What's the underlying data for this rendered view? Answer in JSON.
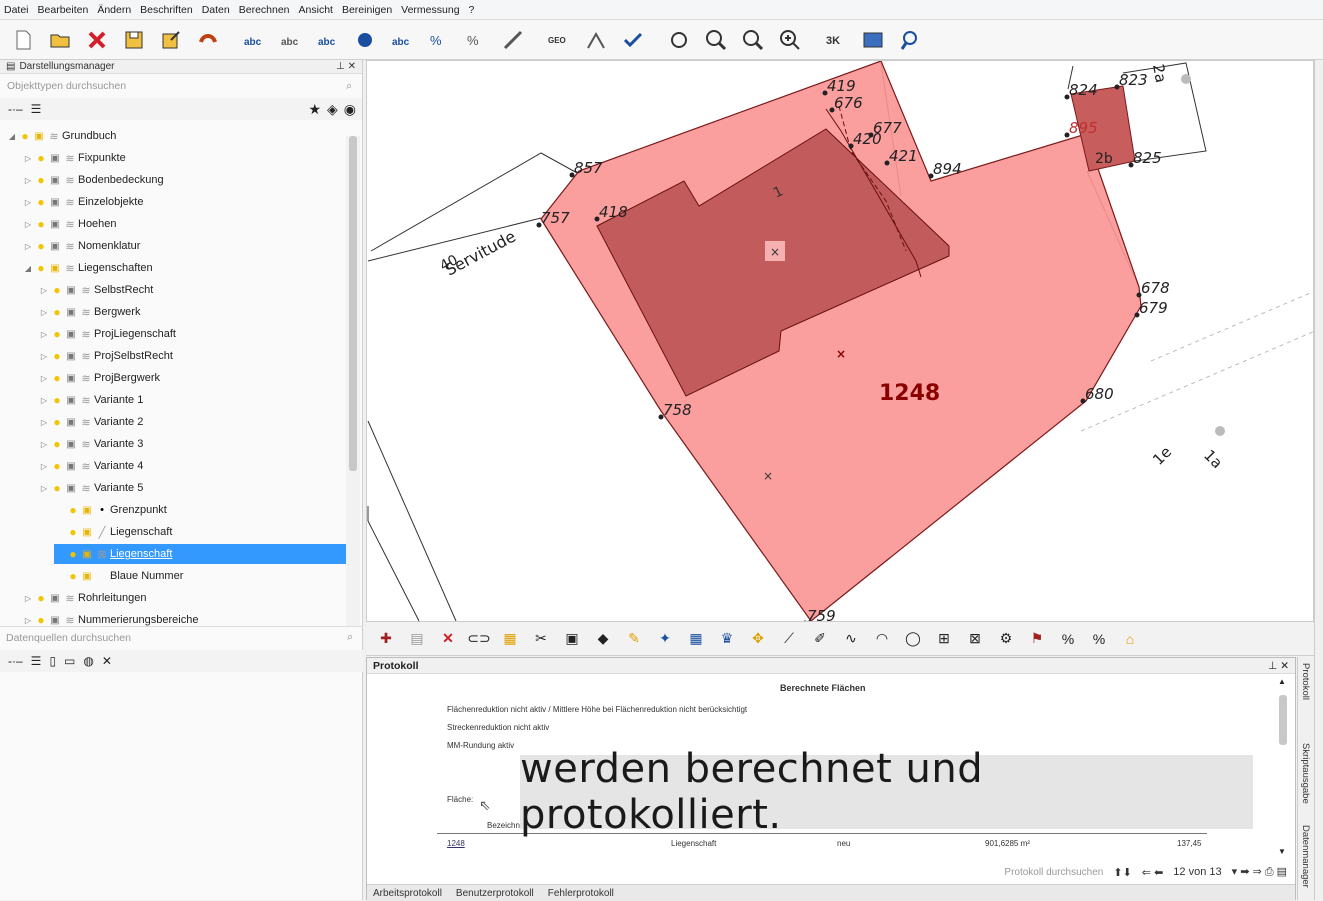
{
  "menu": [
    "Datei",
    "Bearbeiten",
    "Ändern",
    "Beschriften",
    "Daten",
    "Berechnen",
    "Ansicht",
    "Bereinigen",
    "Vermessung",
    "?"
  ],
  "display_manager": {
    "title": "Darstellungsmanager",
    "search_placeholder": "Objekttypen durchsuchen",
    "items": [
      {
        "label": "Grundbuch",
        "level": 0,
        "exp": "◢"
      },
      {
        "label": "Fixpunkte",
        "level": 1,
        "exp": "▷"
      },
      {
        "label": "Bodenbedeckung",
        "level": 1,
        "exp": "▷"
      },
      {
        "label": "Einzelobjekte",
        "level": 1,
        "exp": "▷"
      },
      {
        "label": "Hoehen",
        "level": 1,
        "exp": "▷"
      },
      {
        "label": "Nomenklatur",
        "level": 1,
        "exp": "▷"
      },
      {
        "label": "Liegenschaften",
        "level": 1,
        "exp": "◢"
      },
      {
        "label": "SelbstRecht",
        "level": 2,
        "exp": "▷"
      },
      {
        "label": "Bergwerk",
        "level": 2,
        "exp": "▷"
      },
      {
        "label": "ProjLiegenschaft",
        "level": 2,
        "exp": "▷"
      },
      {
        "label": "ProjSelbstRecht",
        "level": 2,
        "exp": "▷"
      },
      {
        "label": "ProjBergwerk",
        "level": 2,
        "exp": "▷"
      },
      {
        "label": "Variante 1",
        "level": 2,
        "exp": "▷"
      },
      {
        "label": "Variante 2",
        "level": 2,
        "exp": "▷"
      },
      {
        "label": "Variante 3",
        "level": 2,
        "exp": "▷"
      },
      {
        "label": "Variante 4",
        "level": 2,
        "exp": "▷"
      },
      {
        "label": "Variante 5",
        "level": 2,
        "exp": "▷"
      },
      {
        "label": "Grenzpunkt",
        "level": 3,
        "exp": ""
      },
      {
        "label": "Liegenschaft",
        "level": 3,
        "exp": ""
      },
      {
        "label": "Liegenschaft",
        "level": 3,
        "exp": "",
        "selected": true
      },
      {
        "label": "Blaue Nummer",
        "level": 3,
        "exp": ""
      },
      {
        "label": "Rohrleitungen",
        "level": 1,
        "exp": "▷"
      },
      {
        "label": "Nummerierungsbereiche",
        "level": 1,
        "exp": "▷"
      }
    ]
  },
  "datasources": {
    "search_placeholder": "Datenquellen durchsuchen"
  },
  "map": {
    "parcel_number": "1248",
    "points": [
      "419",
      "676",
      "677",
      "420",
      "421",
      "894",
      "857",
      "757",
      "418",
      "824",
      "823",
      "895",
      "825",
      "678",
      "679",
      "680",
      "758",
      "759"
    ],
    "labels": {
      "servitude": "Servitude",
      "num_40": "40",
      "building": "1",
      "a2": "2a",
      "b2": "2b",
      "e1": "1e",
      "a1": "1a"
    }
  },
  "protokoll": {
    "title": "Protokoll",
    "heading": "Berechnete Flächen",
    "lines": [
      "Flächenreduktion nicht aktiv / Mittlere Höhe bei Flächenreduktion nicht berücksichtigt",
      "Streckenreduktion nicht aktiv",
      "MM-Rundung aktiv"
    ],
    "flaeche_label": "Fläche:",
    "bezeichnung_label": "Bezeichn",
    "row": {
      "nr": "1248",
      "type": "Liegenschaft",
      "status": "neu",
      "area": "901,6285 m²",
      "value": "137,45"
    },
    "search_placeholder": "Protokoll durchsuchen",
    "page": "12 von 13",
    "tabs": [
      "Arbeitsprotokoll",
      "Benutzerprotokoll",
      "Fehlerprotokoll"
    ],
    "side_tabs": [
      "Protokoll",
      "Skriptausgabe",
      "Datenmanager"
    ]
  },
  "subtitle": "werden berechnet und protokolliert."
}
